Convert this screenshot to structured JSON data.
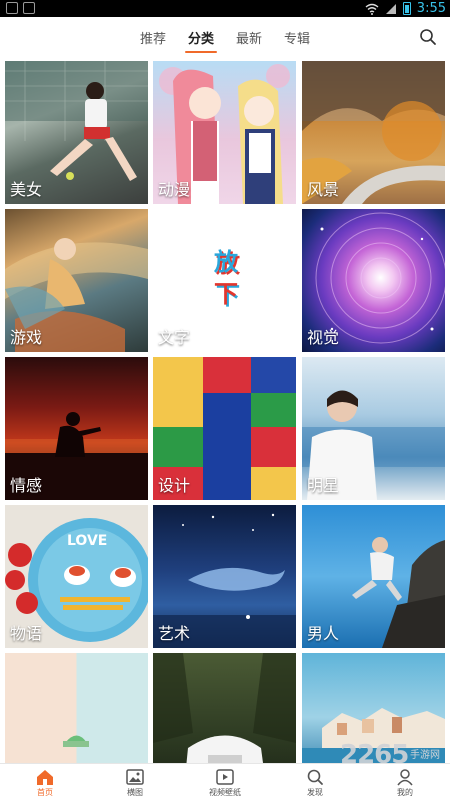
{
  "status_bar": {
    "time": "3:55"
  },
  "top_tabs": [
    {
      "label": "推荐"
    },
    {
      "label": "分类",
      "active": true
    },
    {
      "label": "最新"
    },
    {
      "label": "专辑"
    }
  ],
  "categories": [
    {
      "label": "美女"
    },
    {
      "label": "动漫"
    },
    {
      "label": "风景"
    },
    {
      "label": "游戏"
    },
    {
      "label": "文字",
      "center_text": "放下"
    },
    {
      "label": "视觉"
    },
    {
      "label": "情感"
    },
    {
      "label": "设计"
    },
    {
      "label": "明星"
    },
    {
      "label": "物语",
      "overlay_text": "LOVE"
    },
    {
      "label": "艺术"
    },
    {
      "label": "男人"
    },
    {
      "label": ""
    },
    {
      "label": ""
    },
    {
      "label": ""
    }
  ],
  "bottom_nav": [
    {
      "label": "首页",
      "icon": "home-icon",
      "active": true
    },
    {
      "label": "横图",
      "icon": "image-icon"
    },
    {
      "label": "视频壁纸",
      "icon": "play-icon"
    },
    {
      "label": "发现",
      "icon": "search-icon"
    },
    {
      "label": "我的",
      "icon": "user-icon"
    }
  ],
  "watermark": "2265",
  "watermark_sub": "手游网",
  "colors": {
    "accent": "#f06a2a"
  }
}
